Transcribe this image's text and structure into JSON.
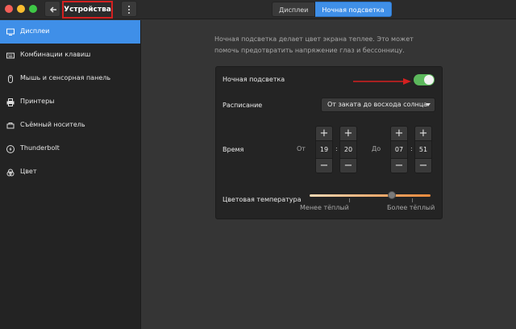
{
  "header": {
    "title": "Устройства",
    "tabs": [
      {
        "label": "Дисплеи",
        "active": false
      },
      {
        "label": "Ночная подсветка",
        "active": true
      }
    ]
  },
  "sidebar": {
    "items": [
      {
        "label": "Дисплеи",
        "icon": "display-icon",
        "active": true
      },
      {
        "label": "Комбинации клавиш",
        "icon": "keyboard-icon"
      },
      {
        "label": "Мышь и сенсорная панель",
        "icon": "mouse-icon"
      },
      {
        "label": "Принтеры",
        "icon": "printer-icon"
      },
      {
        "label": "Съёмный носитель",
        "icon": "removable-media-icon"
      },
      {
        "label": "Thunderbolt",
        "icon": "thunderbolt-icon"
      },
      {
        "label": "Цвет",
        "icon": "color-icon"
      }
    ]
  },
  "main": {
    "intro": "Ночная подсветка делает цвет экрана теплее. Это может помочь предотвратить напряжение глаз и бессонницу.",
    "night_light": {
      "label": "Ночная подсветка",
      "enabled": true
    },
    "schedule": {
      "label": "Расписание",
      "value": "От заката до восхода солнца"
    },
    "time": {
      "label": "Время",
      "from_label": "От",
      "to_label": "До",
      "from_hour": "19",
      "from_minute": "20",
      "to_hour": "07",
      "to_minute": "51",
      "separator": ":",
      "plus": "+",
      "minus": "−"
    },
    "temperature": {
      "label": "Цветовая температура",
      "less_warm": "Менее тёплый",
      "more_warm": "Более тёплый",
      "level": 0.68
    }
  },
  "colors": {
    "accent": "#3f8fe8",
    "switch_on": "#5cb85c",
    "highlight": "#d42020"
  }
}
